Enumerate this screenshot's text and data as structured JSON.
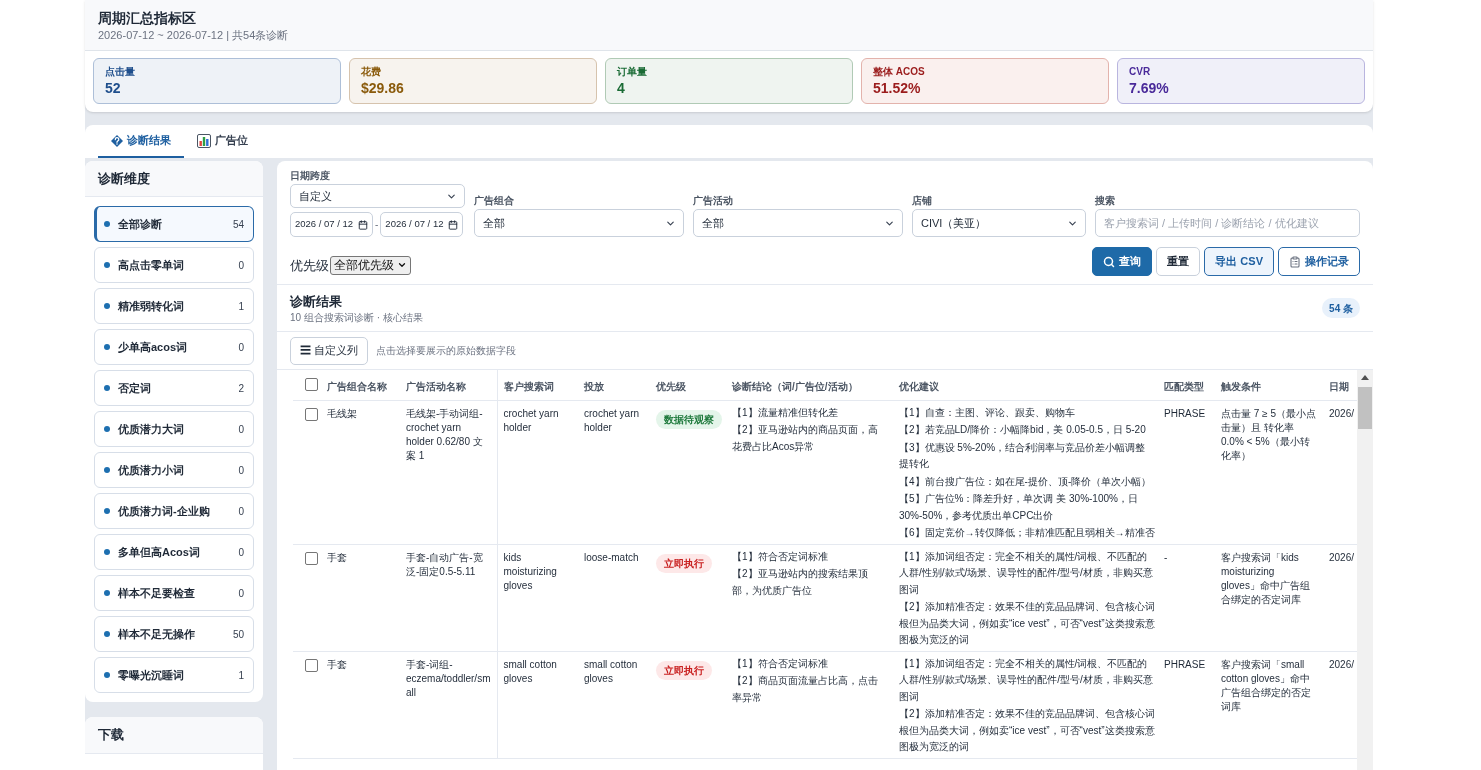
{
  "summary": {
    "title": "周期汇总指标区",
    "subtitle": "2026-07-12 ~ 2026-07-12 | 共54条诊断",
    "metrics": [
      {
        "label": "点击量",
        "value": "52",
        "color": "#1e4e8c"
      },
      {
        "label": "花费",
        "value": "$29.86",
        "color": "#8a5a0b"
      },
      {
        "label": "订单量",
        "value": "4",
        "color": "#1a6b35"
      },
      {
        "label": "整体 ACOS",
        "value": "51.52%",
        "color": "#9b1c1c"
      },
      {
        "label": "CVR",
        "value": "7.69%",
        "color": "#4a2a9a"
      }
    ]
  },
  "tabs": [
    {
      "label": "诊断结果",
      "selected": true
    },
    {
      "label": "广告位",
      "selected": false
    }
  ],
  "sidebar": {
    "title": "诊断维度",
    "items": [
      {
        "label": "全部诊断",
        "count": "54",
        "selected": true
      },
      {
        "label": "高点击零单词",
        "count": "0",
        "selected": false
      },
      {
        "label": "精准弱转化词",
        "count": "1",
        "selected": false
      },
      {
        "label": "少单高acos词",
        "count": "0",
        "selected": false
      },
      {
        "label": "否定词",
        "count": "2",
        "selected": false
      },
      {
        "label": "优质潜力大词",
        "count": "0",
        "selected": false
      },
      {
        "label": "优质潜力小词",
        "count": "0",
        "selected": false
      },
      {
        "label": "优质潜力词-企业购",
        "count": "0",
        "selected": false
      },
      {
        "label": "多单但高Acos词",
        "count": "0",
        "selected": false
      },
      {
        "label": "样本不足要检查",
        "count": "0",
        "selected": false
      },
      {
        "label": "样本不足无操作",
        "count": "50",
        "selected": false
      },
      {
        "label": "零曝光沉睡词",
        "count": "1",
        "selected": false
      }
    ]
  },
  "download": {
    "title": "下载"
  },
  "filters": {
    "date_range": {
      "label": "日期跨度",
      "value": "自定义",
      "start": "2026 / 07 / 12",
      "separator": "-",
      "end": "2026 / 07 / 12"
    },
    "selects": [
      {
        "label": "广告组合",
        "value": "全部"
      },
      {
        "label": "广告活动",
        "value": "全部"
      },
      {
        "label": "店铺",
        "value": "CIVI（美亚）"
      }
    ],
    "search": {
      "label": "搜索",
      "placeholder": "客户搜索词 / 上传时间 / 诊断结论 / 优化建议"
    },
    "priority": {
      "label": "优先级",
      "value": "全部优先级"
    },
    "buttons": [
      {
        "label": "查询",
        "kind": "primary"
      },
      {
        "label": "重置",
        "kind": "plain"
      },
      {
        "label": "导出 CSV",
        "kind": "soft"
      },
      {
        "label": "操作记录",
        "kind": "outline"
      }
    ]
  },
  "results": {
    "title": "诊断结果",
    "subtitle": "10 组合搜索词诊断 · 核心结果",
    "count_badge": "54 条",
    "columns_button": "☰ 自定义列",
    "columns_hint": "点击选择要展示的原始数据字段",
    "table": {
      "select_all_checked": false,
      "columns": [
        "广告组合名称",
        "广告活动名称",
        "客户搜索词",
        "投放",
        "优先级",
        "诊断结论（词/广告位/活动）",
        "优化建议",
        "匹配类型",
        "触发条件",
        "日期"
      ],
      "rows": [
        {
          "checked": false,
          "ad_group": "毛线架",
          "campaign": "毛线架-手动词组-crochet yarn holder 0.62/80 文案 1",
          "search_term": "crochet yarn holder",
          "targeting": "crochet yarn holder",
          "priority": {
            "label": "数据待观察",
            "kind": "observe"
          },
          "diagnosis": [
            "【1】流量精准但转化差",
            "【2】亚马逊站内的商品页面，高花费占比Acos异常"
          ],
          "suggestions": [
            "【1】自查：主图、评论、跟卖、购物车",
            "【2】若竞品LD/降价：小幅降bid，美 0.05-0.5，日 5-20",
            "【3】优惠设 5%-20%，结合利润率与竞品价差小幅调整提转化",
            "【4】前台搜广告位：如在尾-提价、顶-降价（单次小幅）",
            "【5】广告位%：降差升好，单次调 美 30%-100%，日 30%-50%，参考优质出单CPC出价",
            "【6】固定竞价→转仅降低；非精准匹配且弱相关→精准否"
          ],
          "match_type": "PHRASE",
          "trigger": "点击量 7 ≥ 5（最小点击量）且 转化率 0.0% < 5%（最小转化率）",
          "date": "2026/"
        },
        {
          "checked": false,
          "ad_group": "手套",
          "campaign": "手套-自动广告-宽泛-固定0.5-5.11",
          "search_term": "kids moisturizing gloves",
          "targeting": "loose-match",
          "priority": {
            "label": "立即执行",
            "kind": "urgent"
          },
          "diagnosis": [
            "【1】符合否定词标准",
            "【2】亚马逊站内的搜索结果顶部，为优质广告位"
          ],
          "suggestions": [
            "【1】添加词组否定：完全不相关的属性/词根、不匹配的人群/性别/款式/场景、误导性的配件/型号/材质，非购买意图词",
            "【2】添加精准否定：效果不佳的竞品品牌词、包含核心词根但为品类大词，例如卖“ice vest”，可否“vest”这类搜索意图极为宽泛的词"
          ],
          "match_type": "-",
          "trigger": "客户搜索词「kids moisturizing gloves」命中广告组合绑定的否定词库",
          "date": "2026/"
        },
        {
          "checked": false,
          "ad_group": "手套",
          "campaign": "手套-词组-eczema/toddler/small",
          "search_term": "small cotton gloves",
          "targeting": "small cotton gloves",
          "priority": {
            "label": "立即执行",
            "kind": "urgent"
          },
          "diagnosis": [
            "【1】符合否定词标准",
            "【2】商品页面流量占比高，点击率异常"
          ],
          "suggestions": [
            "【1】添加词组否定：完全不相关的属性/词根、不匹配的人群/性别/款式/场景、误导性的配件/型号/材质，非购买意图词",
            "【2】添加精准否定：效果不佳的竞品品牌词、包含核心词根但为品类大词，例如卖“ice vest”，可否“vest”这类搜索意图极为宽泛的词"
          ],
          "match_type": "PHRASE",
          "trigger": "客户搜索词「small cotton gloves」命中广告组合绑定的否定词库",
          "date": "2026/"
        }
      ]
    }
  }
}
